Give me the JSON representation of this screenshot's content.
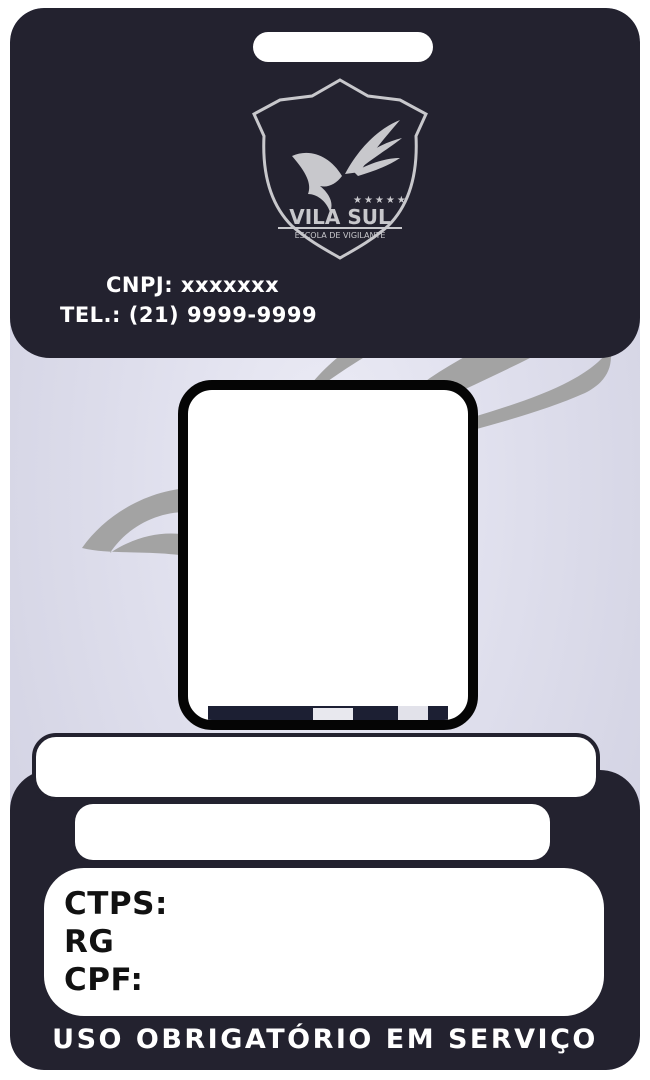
{
  "logo": {
    "name": "VILA SUL",
    "subtitle": "ESCOLA DE VIGILANTE",
    "stars": "★★★★★"
  },
  "company": {
    "cnpj": "CNPJ: xxxxxxx",
    "tel": "TEL.: (21) 9999-9999"
  },
  "fields": {
    "name_value": "",
    "role_value": "",
    "ctps_label": "CTPS:",
    "rg_label": "RG",
    "cpf_label": "CPF:"
  },
  "footer": "USO OBRIGATÓRIO EM SERVIÇO",
  "colors": {
    "band": "#23222f",
    "background": "#dedeec",
    "swoosh": "#a3a3a3"
  }
}
